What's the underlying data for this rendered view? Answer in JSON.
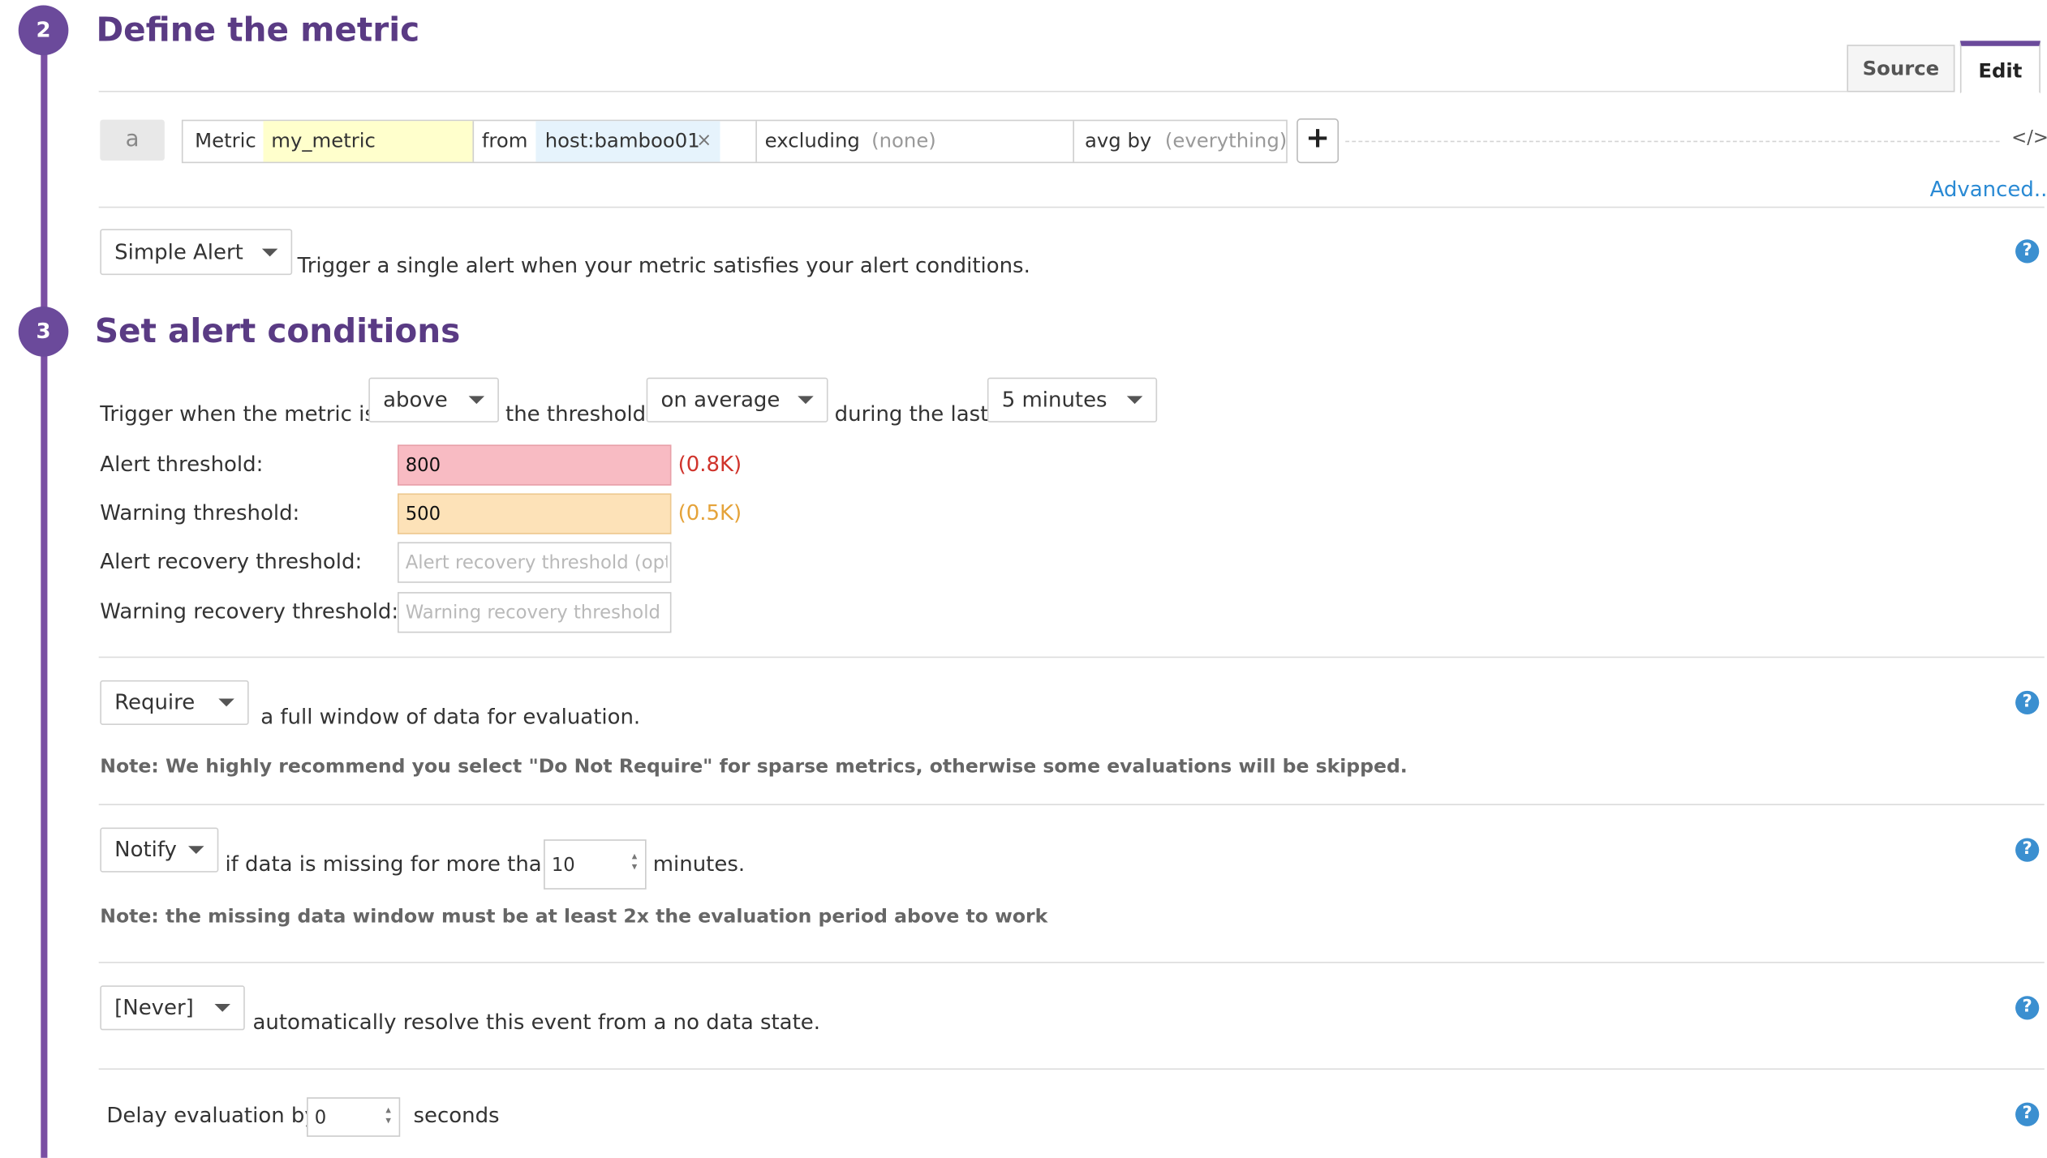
{
  "steps": [
    {
      "number": "2",
      "title": "Define the metric"
    },
    {
      "number": "3",
      "title": "Set alert conditions"
    }
  ],
  "tabs": {
    "source": "Source",
    "edit": "Edit"
  },
  "query": {
    "letter": "a",
    "metric_label": "Metric",
    "metric_value": "my_metric",
    "from_label": "from",
    "from_tag": "host:bamboo01",
    "remove_symbol": "×",
    "excluding_label": "excluding",
    "excluding_value": "(none)",
    "avg_by_label": "avg by",
    "avg_by_value": "(everything)",
    "add_symbol": "+",
    "code_symbol": "</>",
    "advanced_link": "Advanced..."
  },
  "alert_type": {
    "selected": "Simple Alert",
    "description": "Trigger a single alert when your metric satisfies your alert conditions."
  },
  "conditions": {
    "trigger_prefix": "Trigger when the metric is",
    "comparator": "above",
    "threshold_text": "the threshold",
    "aggregation": "on average",
    "during_text": "during the last",
    "timeframe": "5 minutes"
  },
  "thresholds": [
    {
      "label": "Alert threshold:",
      "value": "800",
      "hint": "(0.8K)",
      "placeholder": ""
    },
    {
      "label": "Warning threshold:",
      "value": "500",
      "hint": "(0.5K)",
      "placeholder": ""
    },
    {
      "label": "Alert recovery threshold:",
      "value": "",
      "hint": "",
      "placeholder": "Alert recovery threshold (optional)"
    },
    {
      "label": "Warning recovery threshold:",
      "value": "",
      "hint": "",
      "placeholder": "Warning recovery threshold"
    }
  ],
  "require": {
    "selected": "Require",
    "text": "a full window of data for evaluation.",
    "note": "Note: We highly recommend you select \"Do Not Require\" for sparse metrics, otherwise some evaluations will be skipped."
  },
  "notify": {
    "selected": "Notify",
    "text_before": "if data is missing for more than",
    "value": "10",
    "text_after": "minutes.",
    "note": "Note: the missing data window must be at least 2x the evaluation period above to work"
  },
  "resolve": {
    "selected": "[Never]",
    "text": "automatically resolve this event from a no data state."
  },
  "delay": {
    "prefix": "Delay evaluation by",
    "value": "0",
    "suffix": "seconds"
  },
  "help_symbol": "?",
  "colors": {
    "accent": "#6b4a9b",
    "alert_bg": "#f8bbc3",
    "alert_text": "#d0342c",
    "warning_bg": "#fde2b8",
    "warning_text": "#e5a33a",
    "metric_bg": "#ffffcc",
    "tag_bg": "#e6f3fc",
    "link": "#2a8ad4"
  }
}
